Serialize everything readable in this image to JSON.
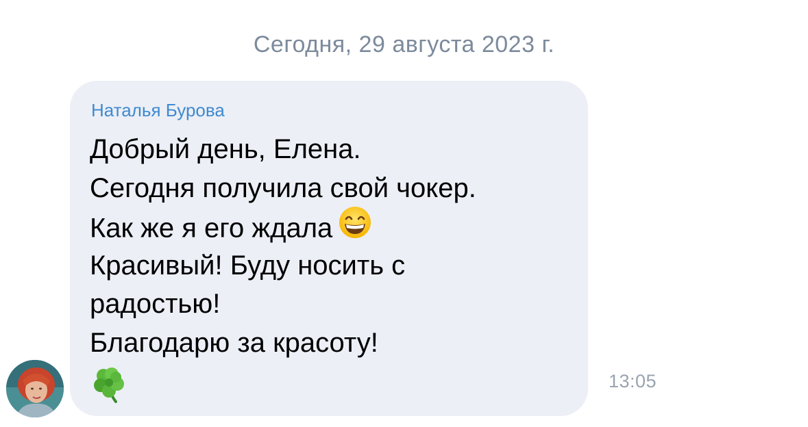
{
  "date_separator": "Сегодня, 29 августа 2023 г.",
  "message": {
    "sender": "Наталья Бурова",
    "lines": [
      "Добрый день, Елена.",
      "Сегодня получила свой чокер.",
      "Как же я его ждала",
      "Красивый! Буду носить с",
      "радостью!",
      "Благодарю за красоту!"
    ],
    "time": "13:05"
  },
  "icons": {
    "smile": "grinning-face-icon",
    "clover": "shamrock-icon",
    "avatar": "user-avatar"
  },
  "colors": {
    "bubble": "#eceff6",
    "sender_name": "#3f8ad0",
    "date": "#7c8a9c",
    "time": "#9aa3b0"
  }
}
